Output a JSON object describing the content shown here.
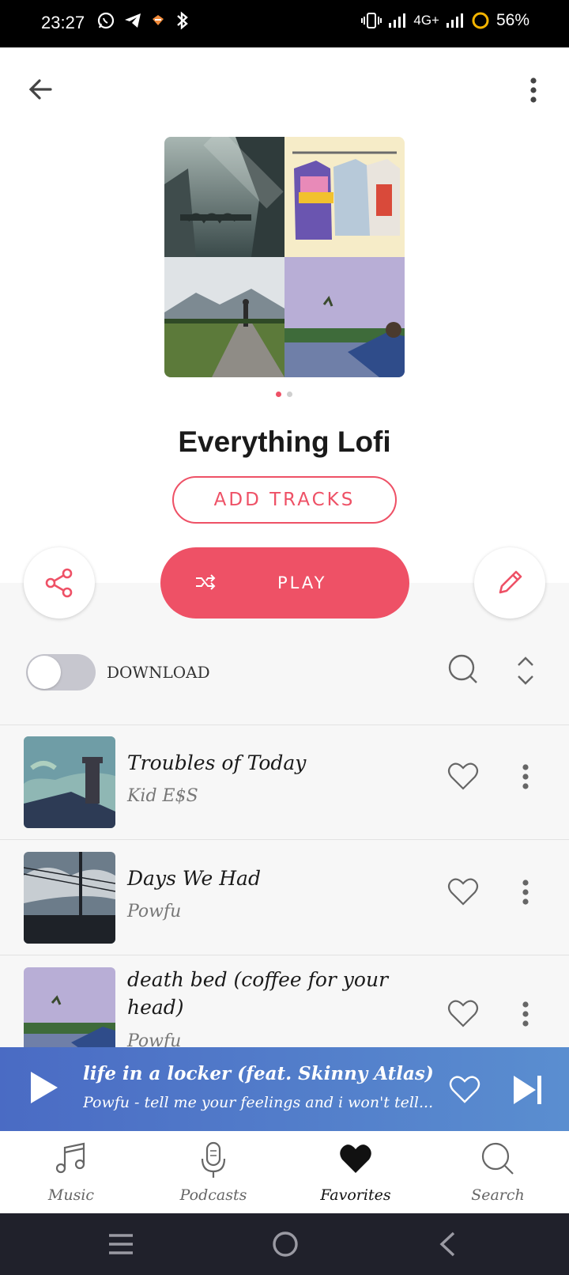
{
  "status_bar": {
    "time": "23:27",
    "network": "4G+",
    "battery": "56%"
  },
  "header": {
    "back_icon": "arrow-left-icon",
    "menu_icon": "more-vertical-icon"
  },
  "playlist": {
    "title": "Everything Lofi",
    "add_tracks_label": "ADD TRACKS",
    "play_label": "PLAY",
    "carousel_page": 1,
    "carousel_pages": 2
  },
  "controls": {
    "download_label": "DOWNLOAD",
    "download_enabled": false
  },
  "tracks": [
    {
      "title": "Troubles of Today",
      "artist": "Kid E$S"
    },
    {
      "title": "Days We Had",
      "artist": "Powfu"
    },
    {
      "title": "death bed (coffee for your head)",
      "artist": "Powfu"
    }
  ],
  "now_playing": {
    "title": "life in a locker (feat. Skinny Atlas)",
    "subtitle": "Powfu - tell me your feelings and i won't tell..."
  },
  "bottom_nav": {
    "items": [
      {
        "label": "Music",
        "icon": "music-note-icon"
      },
      {
        "label": "Podcasts",
        "icon": "microphone-icon"
      },
      {
        "label": "Favorites",
        "icon": "heart-icon"
      },
      {
        "label": "Search",
        "icon": "search-icon"
      }
    ],
    "active": "Favorites"
  },
  "colors": {
    "accent": "#ee5166",
    "player_start": "#4a6bc4",
    "player_end": "#5a8ed0",
    "system_nav": "#20212b"
  }
}
